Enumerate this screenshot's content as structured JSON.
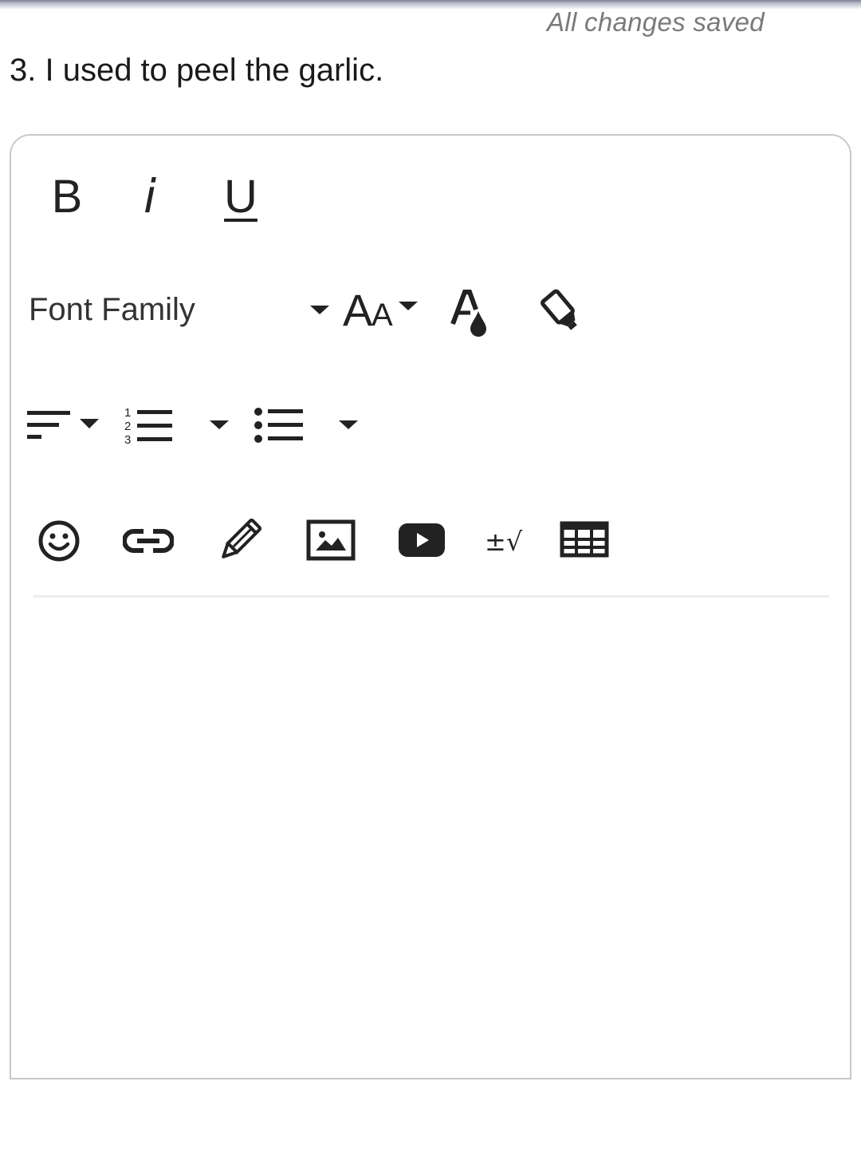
{
  "header": {
    "save_status": "All changes saved"
  },
  "question": {
    "text": "3. I used to peel the garlic."
  },
  "toolbar": {
    "bold_label": "B",
    "italic_label": "i",
    "underline_label": "U",
    "font_family_label": "Font Family",
    "icons": {
      "font_family_dropdown": "chevron-down-icon",
      "font_size": "font-size-icon",
      "font_color": "font-color-icon",
      "highlight": "highlighter-icon",
      "align": "align-left-icon",
      "ordered_list": "ordered-list-icon",
      "unordered_list": "unordered-list-icon",
      "emoji": "emoji-icon",
      "link": "link-icon",
      "draw": "pencil-icon",
      "image": "image-icon",
      "video": "video-icon",
      "math": "math-icon",
      "table": "table-icon"
    }
  },
  "editor": {
    "content": ""
  },
  "colors": {
    "icon": "#222222",
    "status_text": "#7a7a7a",
    "border": "#c8c8c8",
    "divider": "#ececec"
  }
}
